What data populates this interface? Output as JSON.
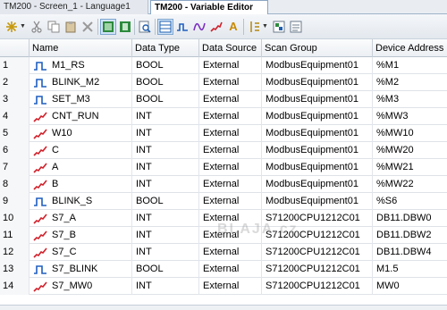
{
  "tabs": [
    {
      "label": "TM200 - Screen_1 - Language1"
    },
    {
      "label": "TM200 - Variable Editor"
    }
  ],
  "toolbar": {
    "icons": [
      "new-variable-icon",
      "cut-icon",
      "copy-icon",
      "paste-icon",
      "delete-icon",
      "grid-view-icon",
      "list-view-icon",
      "find-icon",
      "table-view-icon",
      "boolean-filter-icon",
      "analog-filter-icon",
      "trend-filter-icon",
      "text-filter-icon",
      "sort-icon",
      "export-icon",
      "import-icon"
    ]
  },
  "columns": [
    "Name",
    "Data Type",
    "Data Source",
    "Scan Group",
    "Device Address"
  ],
  "rows": [
    {
      "num": "1",
      "icon": "bool-icon",
      "name": "M1_RS",
      "type": "BOOL",
      "source": "External",
      "group": "ModbusEquipment01",
      "address": "%M1"
    },
    {
      "num": "2",
      "icon": "bool-icon",
      "name": "BLINK_M2",
      "type": "BOOL",
      "source": "External",
      "group": "ModbusEquipment01",
      "address": "%M2"
    },
    {
      "num": "3",
      "icon": "bool-icon",
      "name": "SET_M3",
      "type": "BOOL",
      "source": "External",
      "group": "ModbusEquipment01",
      "address": "%M3"
    },
    {
      "num": "4",
      "icon": "int-icon",
      "name": "CNT_RUN",
      "type": "INT",
      "source": "External",
      "group": "ModbusEquipment01",
      "address": "%MW3"
    },
    {
      "num": "5",
      "icon": "int-icon",
      "name": "W10",
      "type": "INT",
      "source": "External",
      "group": "ModbusEquipment01",
      "address": "%MW10"
    },
    {
      "num": "6",
      "icon": "int-icon",
      "name": "C",
      "type": "INT",
      "source": "External",
      "group": "ModbusEquipment01",
      "address": "%MW20"
    },
    {
      "num": "7",
      "icon": "int-icon",
      "name": "A",
      "type": "INT",
      "source": "External",
      "group": "ModbusEquipment01",
      "address": "%MW21"
    },
    {
      "num": "8",
      "icon": "int-icon",
      "name": "B",
      "type": "INT",
      "source": "External",
      "group": "ModbusEquipment01",
      "address": "%MW22"
    },
    {
      "num": "9",
      "icon": "bool-icon",
      "name": "BLINK_S",
      "type": "BOOL",
      "source": "External",
      "group": "ModbusEquipment01",
      "address": "%S6"
    },
    {
      "num": "10",
      "icon": "int-icon",
      "name": "S7_A",
      "type": "INT",
      "source": "External",
      "group": "S71200CPU1212C01",
      "address": "DB11.DBW0"
    },
    {
      "num": "11",
      "icon": "int-icon",
      "name": "S7_B",
      "type": "INT",
      "source": "External",
      "group": "S71200CPU1212C01",
      "address": "DB11.DBW2"
    },
    {
      "num": "12",
      "icon": "int-icon",
      "name": "S7_C",
      "type": "INT",
      "source": "External",
      "group": "S71200CPU1212C01",
      "address": "DB11.DBW4"
    },
    {
      "num": "13",
      "icon": "bool-icon",
      "name": "S7_BLINK",
      "type": "BOOL",
      "source": "External",
      "group": "S71200CPU1212C01",
      "address": "M1.5"
    },
    {
      "num": "14",
      "icon": "int-icon",
      "name": "S7_MW0",
      "type": "INT",
      "source": "External",
      "group": "S71200CPU1212C01",
      "address": "MW0"
    }
  ],
  "watermark": "BLAJA.cz",
  "colors": {
    "bool_icon": "#1f5fbf",
    "int_icon": "#d0202a"
  }
}
